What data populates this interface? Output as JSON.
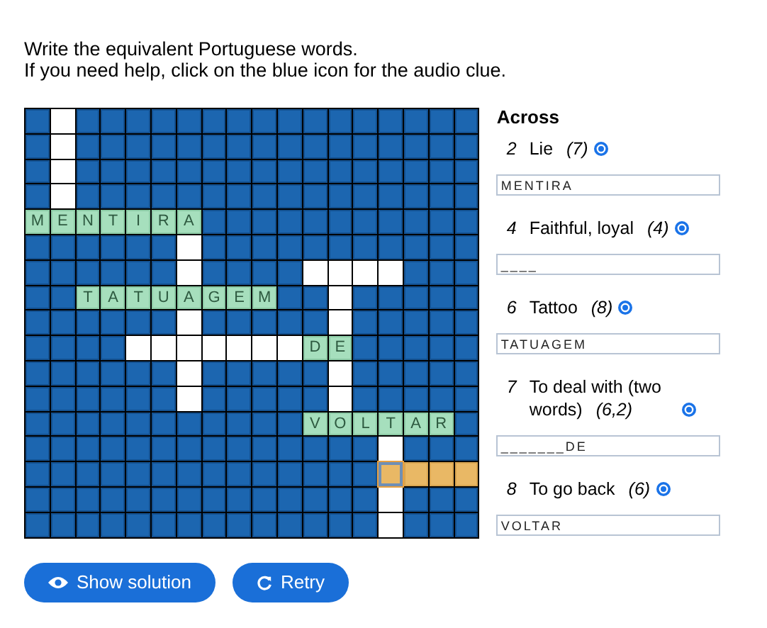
{
  "instructions": [
    "Write the equivalent Portuguese words.",
    "If you need help, click on the blue icon for the audio clue."
  ],
  "grid": {
    "rows": [
      [
        {
          "kind": "block"
        },
        {
          "kind": "empty"
        },
        {
          "kind": "block"
        },
        {
          "kind": "block"
        },
        {
          "kind": "block"
        },
        {
          "kind": "block"
        },
        {
          "kind": "block"
        },
        {
          "kind": "block"
        },
        {
          "kind": "block"
        },
        {
          "kind": "block"
        },
        {
          "kind": "block"
        },
        {
          "kind": "block"
        },
        {
          "kind": "block"
        },
        {
          "kind": "block"
        },
        {
          "kind": "block"
        },
        {
          "kind": "block"
        },
        {
          "kind": "block"
        },
        {
          "kind": "block"
        }
      ],
      [
        {
          "kind": "block"
        },
        {
          "kind": "empty"
        },
        {
          "kind": "block"
        },
        {
          "kind": "block"
        },
        {
          "kind": "block"
        },
        {
          "kind": "block"
        },
        {
          "kind": "block"
        },
        {
          "kind": "block"
        },
        {
          "kind": "block"
        },
        {
          "kind": "block"
        },
        {
          "kind": "block"
        },
        {
          "kind": "block"
        },
        {
          "kind": "block"
        },
        {
          "kind": "block"
        },
        {
          "kind": "block"
        },
        {
          "kind": "block"
        },
        {
          "kind": "block"
        },
        {
          "kind": "block"
        }
      ],
      [
        {
          "kind": "block"
        },
        {
          "kind": "empty"
        },
        {
          "kind": "block"
        },
        {
          "kind": "block"
        },
        {
          "kind": "block"
        },
        {
          "kind": "block"
        },
        {
          "kind": "block"
        },
        {
          "kind": "block"
        },
        {
          "kind": "block"
        },
        {
          "kind": "block"
        },
        {
          "kind": "block"
        },
        {
          "kind": "block"
        },
        {
          "kind": "block"
        },
        {
          "kind": "block"
        },
        {
          "kind": "block"
        },
        {
          "kind": "block"
        },
        {
          "kind": "block"
        },
        {
          "kind": "block"
        }
      ],
      [
        {
          "kind": "block"
        },
        {
          "kind": "empty"
        },
        {
          "kind": "block"
        },
        {
          "kind": "block"
        },
        {
          "kind": "block"
        },
        {
          "kind": "block"
        },
        {
          "kind": "block"
        },
        {
          "kind": "block"
        },
        {
          "kind": "block"
        },
        {
          "kind": "block"
        },
        {
          "kind": "block"
        },
        {
          "kind": "block"
        },
        {
          "kind": "block"
        },
        {
          "kind": "block"
        },
        {
          "kind": "block"
        },
        {
          "kind": "block"
        },
        {
          "kind": "block"
        },
        {
          "kind": "block"
        }
      ],
      [
        {
          "kind": "letter",
          "text": "M"
        },
        {
          "kind": "letter",
          "text": "E"
        },
        {
          "kind": "letter",
          "text": "N"
        },
        {
          "kind": "letter",
          "text": "T"
        },
        {
          "kind": "letter",
          "text": "I"
        },
        {
          "kind": "letter",
          "text": "R"
        },
        {
          "kind": "letter",
          "text": "A"
        },
        {
          "kind": "block"
        },
        {
          "kind": "block"
        },
        {
          "kind": "block"
        },
        {
          "kind": "block"
        },
        {
          "kind": "block"
        },
        {
          "kind": "block"
        },
        {
          "kind": "block"
        },
        {
          "kind": "block"
        },
        {
          "kind": "block"
        },
        {
          "kind": "block"
        },
        {
          "kind": "block"
        }
      ],
      [
        {
          "kind": "block"
        },
        {
          "kind": "block"
        },
        {
          "kind": "block"
        },
        {
          "kind": "block"
        },
        {
          "kind": "block"
        },
        {
          "kind": "block"
        },
        {
          "kind": "empty"
        },
        {
          "kind": "block"
        },
        {
          "kind": "block"
        },
        {
          "kind": "block"
        },
        {
          "kind": "block"
        },
        {
          "kind": "block"
        },
        {
          "kind": "block"
        },
        {
          "kind": "block"
        },
        {
          "kind": "block"
        },
        {
          "kind": "block"
        },
        {
          "kind": "block"
        },
        {
          "kind": "block"
        }
      ],
      [
        {
          "kind": "block"
        },
        {
          "kind": "block"
        },
        {
          "kind": "block"
        },
        {
          "kind": "block"
        },
        {
          "kind": "block"
        },
        {
          "kind": "block"
        },
        {
          "kind": "empty"
        },
        {
          "kind": "block"
        },
        {
          "kind": "block"
        },
        {
          "kind": "block"
        },
        {
          "kind": "block"
        },
        {
          "kind": "empty"
        },
        {
          "kind": "empty"
        },
        {
          "kind": "empty"
        },
        {
          "kind": "empty"
        },
        {
          "kind": "block"
        },
        {
          "kind": "block"
        },
        {
          "kind": "block"
        }
      ],
      [
        {
          "kind": "block"
        },
        {
          "kind": "block"
        },
        {
          "kind": "letter",
          "text": "T"
        },
        {
          "kind": "letter",
          "text": "A"
        },
        {
          "kind": "letter",
          "text": "T"
        },
        {
          "kind": "letter",
          "text": "U"
        },
        {
          "kind": "letter",
          "text": "A"
        },
        {
          "kind": "letter",
          "text": "G"
        },
        {
          "kind": "letter",
          "text": "E"
        },
        {
          "kind": "letter",
          "text": "M"
        },
        {
          "kind": "block"
        },
        {
          "kind": "block"
        },
        {
          "kind": "empty"
        },
        {
          "kind": "block"
        },
        {
          "kind": "block"
        },
        {
          "kind": "block"
        },
        {
          "kind": "block"
        },
        {
          "kind": "block"
        }
      ],
      [
        {
          "kind": "block"
        },
        {
          "kind": "block"
        },
        {
          "kind": "block"
        },
        {
          "kind": "block"
        },
        {
          "kind": "block"
        },
        {
          "kind": "block"
        },
        {
          "kind": "empty"
        },
        {
          "kind": "block"
        },
        {
          "kind": "block"
        },
        {
          "kind": "block"
        },
        {
          "kind": "block"
        },
        {
          "kind": "block"
        },
        {
          "kind": "empty"
        },
        {
          "kind": "block"
        },
        {
          "kind": "block"
        },
        {
          "kind": "block"
        },
        {
          "kind": "block"
        },
        {
          "kind": "block"
        }
      ],
      [
        {
          "kind": "block"
        },
        {
          "kind": "block"
        },
        {
          "kind": "block"
        },
        {
          "kind": "block"
        },
        {
          "kind": "empty"
        },
        {
          "kind": "empty"
        },
        {
          "kind": "empty"
        },
        {
          "kind": "empty"
        },
        {
          "kind": "empty"
        },
        {
          "kind": "empty"
        },
        {
          "kind": "empty"
        },
        {
          "kind": "letter",
          "text": "D"
        },
        {
          "kind": "letter",
          "text": "E"
        },
        {
          "kind": "block"
        },
        {
          "kind": "block"
        },
        {
          "kind": "block"
        },
        {
          "kind": "block"
        },
        {
          "kind": "block"
        }
      ],
      [
        {
          "kind": "block"
        },
        {
          "kind": "block"
        },
        {
          "kind": "block"
        },
        {
          "kind": "block"
        },
        {
          "kind": "block"
        },
        {
          "kind": "block"
        },
        {
          "kind": "empty"
        },
        {
          "kind": "block"
        },
        {
          "kind": "block"
        },
        {
          "kind": "block"
        },
        {
          "kind": "block"
        },
        {
          "kind": "block"
        },
        {
          "kind": "empty"
        },
        {
          "kind": "block"
        },
        {
          "kind": "block"
        },
        {
          "kind": "block"
        },
        {
          "kind": "block"
        },
        {
          "kind": "block"
        }
      ],
      [
        {
          "kind": "block"
        },
        {
          "kind": "block"
        },
        {
          "kind": "block"
        },
        {
          "kind": "block"
        },
        {
          "kind": "block"
        },
        {
          "kind": "block"
        },
        {
          "kind": "empty"
        },
        {
          "kind": "block"
        },
        {
          "kind": "block"
        },
        {
          "kind": "block"
        },
        {
          "kind": "block"
        },
        {
          "kind": "block"
        },
        {
          "kind": "empty"
        },
        {
          "kind": "block"
        },
        {
          "kind": "block"
        },
        {
          "kind": "block"
        },
        {
          "kind": "block"
        },
        {
          "kind": "block"
        }
      ],
      [
        {
          "kind": "block"
        },
        {
          "kind": "block"
        },
        {
          "kind": "block"
        },
        {
          "kind": "block"
        },
        {
          "kind": "block"
        },
        {
          "kind": "block"
        },
        {
          "kind": "block"
        },
        {
          "kind": "block"
        },
        {
          "kind": "block"
        },
        {
          "kind": "block"
        },
        {
          "kind": "block"
        },
        {
          "kind": "letter",
          "text": "V"
        },
        {
          "kind": "letter",
          "text": "O"
        },
        {
          "kind": "letter",
          "text": "L"
        },
        {
          "kind": "letter",
          "text": "T"
        },
        {
          "kind": "letter",
          "text": "A"
        },
        {
          "kind": "letter",
          "text": "R"
        },
        {
          "kind": "block"
        }
      ],
      [
        {
          "kind": "block"
        },
        {
          "kind": "block"
        },
        {
          "kind": "block"
        },
        {
          "kind": "block"
        },
        {
          "kind": "block"
        },
        {
          "kind": "block"
        },
        {
          "kind": "block"
        },
        {
          "kind": "block"
        },
        {
          "kind": "block"
        },
        {
          "kind": "block"
        },
        {
          "kind": "block"
        },
        {
          "kind": "block"
        },
        {
          "kind": "block"
        },
        {
          "kind": "block"
        },
        {
          "kind": "empty"
        },
        {
          "kind": "block"
        },
        {
          "kind": "block"
        },
        {
          "kind": "block"
        }
      ],
      [
        {
          "kind": "block"
        },
        {
          "kind": "block"
        },
        {
          "kind": "block"
        },
        {
          "kind": "block"
        },
        {
          "kind": "block"
        },
        {
          "kind": "block"
        },
        {
          "kind": "block"
        },
        {
          "kind": "block"
        },
        {
          "kind": "block"
        },
        {
          "kind": "block"
        },
        {
          "kind": "block"
        },
        {
          "kind": "block"
        },
        {
          "kind": "block"
        },
        {
          "kind": "block"
        },
        {
          "kind": "focused"
        },
        {
          "kind": "highlighted"
        },
        {
          "kind": "highlighted"
        },
        {
          "kind": "highlighted"
        }
      ],
      [
        {
          "kind": "block"
        },
        {
          "kind": "block"
        },
        {
          "kind": "block"
        },
        {
          "kind": "block"
        },
        {
          "kind": "block"
        },
        {
          "kind": "block"
        },
        {
          "kind": "block"
        },
        {
          "kind": "block"
        },
        {
          "kind": "block"
        },
        {
          "kind": "block"
        },
        {
          "kind": "block"
        },
        {
          "kind": "block"
        },
        {
          "kind": "block"
        },
        {
          "kind": "block"
        },
        {
          "kind": "empty"
        },
        {
          "kind": "block"
        },
        {
          "kind": "block"
        },
        {
          "kind": "block"
        }
      ],
      [
        {
          "kind": "block"
        },
        {
          "kind": "block"
        },
        {
          "kind": "block"
        },
        {
          "kind": "block"
        },
        {
          "kind": "block"
        },
        {
          "kind": "block"
        },
        {
          "kind": "block"
        },
        {
          "kind": "block"
        },
        {
          "kind": "block"
        },
        {
          "kind": "block"
        },
        {
          "kind": "block"
        },
        {
          "kind": "block"
        },
        {
          "kind": "block"
        },
        {
          "kind": "block"
        },
        {
          "kind": "empty"
        },
        {
          "kind": "block"
        },
        {
          "kind": "block"
        },
        {
          "kind": "block"
        }
      ]
    ]
  },
  "clues": {
    "heading": "Across",
    "items": [
      {
        "number": "2",
        "text": "Lie",
        "length": "(7)",
        "value": "MENTIRA"
      },
      {
        "number": "4",
        "text": "Faithful, loyal",
        "length": "(4)",
        "value": "____"
      },
      {
        "number": "6",
        "text": "Tattoo",
        "length": "(8)",
        "value": "TATUAGEM"
      },
      {
        "number": "7",
        "text": "To deal with (two words)",
        "length": "(6,2)",
        "value": "_______DE"
      },
      {
        "number": "8",
        "text": "To go back",
        "length": "(6)",
        "value": "VOLTAR"
      }
    ]
  },
  "buttons": [
    {
      "kind": "show",
      "label": "Show solution"
    },
    {
      "kind": "retry",
      "label": "Retry"
    }
  ]
}
